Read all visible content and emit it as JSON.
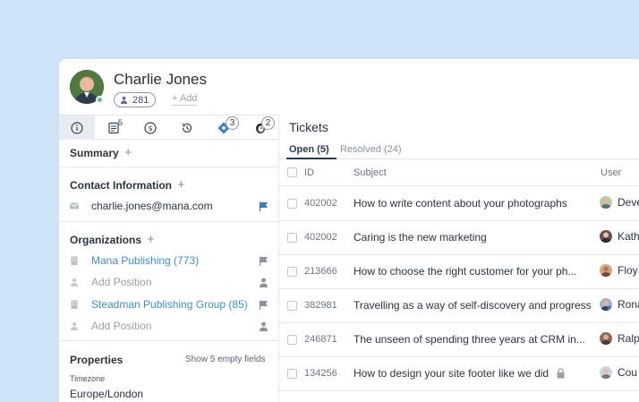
{
  "contact": {
    "name": "Charlie Jones",
    "follower_count": "281",
    "add_label": "+ Add"
  },
  "tabs": [
    {
      "name": "info",
      "icon": "info-icon"
    },
    {
      "name": "notes",
      "icon": "notes-icon",
      "badge": "5"
    },
    {
      "name": "deals",
      "icon": "dollar-icon"
    },
    {
      "name": "history",
      "icon": "history-icon"
    },
    {
      "name": "jira",
      "icon": "jira-icon",
      "badge": "3"
    },
    {
      "name": "mailchimp",
      "icon": "mailchimp-icon",
      "badge": "2"
    }
  ],
  "summary": {
    "title": "Summary"
  },
  "contact_info": {
    "title": "Contact Information",
    "email": "charlie.jones@mana.com"
  },
  "organizations": {
    "title": "Organizations",
    "items": [
      {
        "name": "Mana Publishing (773)",
        "position": "Add Position"
      },
      {
        "name": "Steadman Publishing Group (85)",
        "position": "Add Position"
      }
    ]
  },
  "properties": {
    "title": "Properties",
    "show_empty": "Show 5 empty fields",
    "timezone_label": "Timezone",
    "timezone_value": "Europe/London"
  },
  "tickets": {
    "title": "Tickets",
    "tab_open": "Open (5)",
    "tab_resolved": "Resolved (24)",
    "columns": {
      "id": "ID",
      "subject": "Subject",
      "user": "User"
    },
    "rows": [
      {
        "id": "402002",
        "subject": "How to write content about your photographs",
        "user": "Deve"
      },
      {
        "id": "402002",
        "subject": "Caring is the new marketing",
        "user": "Kath"
      },
      {
        "id": "213666",
        "subject": "How to choose the right customer for your ph...",
        "user": "Floy"
      },
      {
        "id": "382981",
        "subject": "Travelling as a way of self-discovery and progress",
        "user": "Rona"
      },
      {
        "id": "246871",
        "subject": "The unseen of spending three years at CRM in...",
        "user": "Ralp"
      },
      {
        "id": "134256",
        "subject": "How to design your site footer like we did",
        "user": "Cou",
        "locked": true
      }
    ]
  },
  "colors": {
    "background": "#cfe3f7",
    "link": "#3d8fd1",
    "active_tab": "#2a3a59",
    "flag_blue": "#2f7fd0",
    "status_online": "#5fbf9b"
  }
}
